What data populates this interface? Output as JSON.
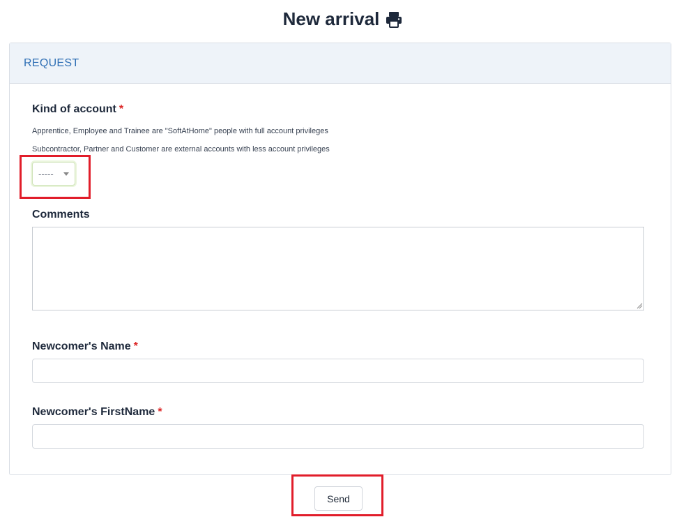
{
  "page": {
    "title": "New arrival",
    "title_icon": "print-icon"
  },
  "card": {
    "header": "REQUEST"
  },
  "account_kind": {
    "label": "Kind of account",
    "required_mark": "*",
    "help_line_1": "Apprentice, Employee and Trainee are \"SoftAtHome\" people with full account privileges",
    "help_line_2": "Subcontractor, Partner and Customer are external accounts with less account privileges",
    "selected_value": "-----"
  },
  "comments": {
    "label": "Comments",
    "value": ""
  },
  "newcomer_name": {
    "label": "Newcomer's Name",
    "required_mark": "*",
    "value": ""
  },
  "newcomer_firstname": {
    "label": "Newcomer's FirstName",
    "required_mark": "*",
    "value": ""
  },
  "actions": {
    "send_label": "Send"
  },
  "colors": {
    "accent": "#2f6fb5",
    "required": "#dc2626",
    "highlight": "#e11d2a"
  }
}
